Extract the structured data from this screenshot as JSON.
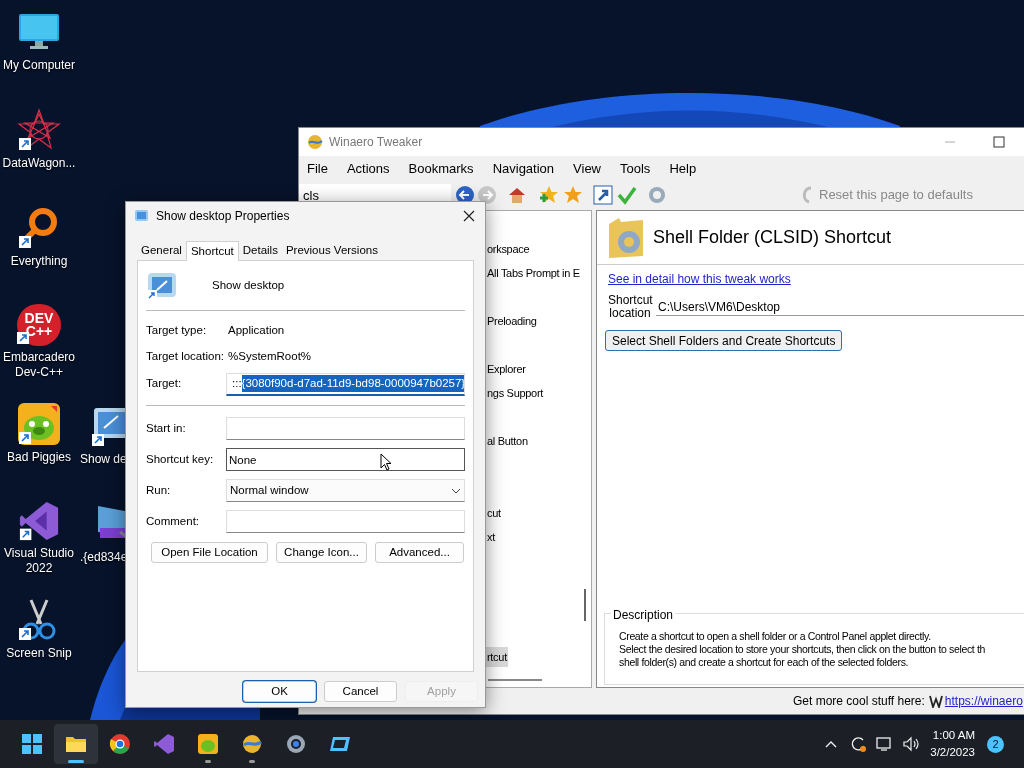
{
  "desktop_icons": [
    {
      "label": "My Computer",
      "shortcut": false
    },
    {
      "label": "DataWagon...",
      "shortcut": true
    },
    {
      "label": "Everything",
      "shortcut": true
    },
    {
      "label": "Embarcadero Dev-C++",
      "shortcut": true,
      "icon_text": [
        "DEV",
        "C++"
      ]
    },
    {
      "label": "Bad Piggies",
      "shortcut": true
    },
    {
      "label": "Visual Studio 2022",
      "shortcut": true
    },
    {
      "label": "Screen Snip",
      "shortcut": true
    }
  ],
  "desktop_icons_2": [
    {
      "label": "Show de",
      "shortcut": true
    },
    {
      "label": ".{ed834e",
      "shortcut": false
    }
  ],
  "winaero": {
    "title": "Winaero Tweaker",
    "menu": [
      "File",
      "Actions",
      "Bookmarks",
      "Navigation",
      "View",
      "Tools",
      "Help"
    ],
    "search": {
      "value": "cls"
    },
    "reset_label": "Reset this page to defaults",
    "tree": [
      {
        "label": "orkspace",
        "selected": false
      },
      {
        "label": "All Tabs Prompt in E",
        "selected": false
      },
      {
        "label": "Preloading",
        "selected": false
      },
      {
        "label": "Explorer",
        "selected": false
      },
      {
        "label": "ngs Support",
        "selected": false
      },
      {
        "label": "al Button",
        "selected": false
      },
      {
        "label": "cut",
        "selected": false
      },
      {
        "label": "xt",
        "selected": false
      },
      {
        "label": "rtcut",
        "selected": true
      }
    ],
    "page": {
      "title": "Shell Folder (CLSID) Shortcut",
      "link": "See in detail how this tweak works",
      "location_label": "Shortcut location",
      "location_value": "C:\\Users\\VM6\\Desktop",
      "button": "Select Shell Folders and Create Shortcuts",
      "description_title": "Description",
      "description": [
        "Create a shortcut to open a shell folder or a Control Panel applet directly.",
        "Select the desired location to store your shortcuts, then click on the button to select th",
        "shell folder(s) and create a shortcut for each of the selected folders."
      ]
    },
    "status": {
      "label": "Get more cool stuff here:",
      "link": "https://winaero"
    }
  },
  "dialog": {
    "title": "Show desktop Properties",
    "tabs": [
      {
        "label": "General",
        "selected": false
      },
      {
        "label": "Shortcut",
        "selected": true
      },
      {
        "label": "Details",
        "selected": false
      },
      {
        "label": "Previous Versions",
        "selected": false
      }
    ],
    "name": "Show desktop",
    "info": [
      {
        "label": "Target type:",
        "value": "Application"
      },
      {
        "label": "Target location:",
        "value": "%SystemRoot%"
      }
    ],
    "target": {
      "label": "Target:",
      "value": ":::",
      "selection": "{3080f90d-d7ad-11d9-bd98-0000947b0257}",
      "focused": true
    },
    "fields": [
      {
        "kind": "text",
        "label": "Start in:",
        "hovered": false
      },
      {
        "kind": "text",
        "label": "Shortcut key:",
        "value": "None",
        "hovered": true
      },
      {
        "kind": "select",
        "label": "Run:",
        "value": "Normal window",
        "hovered": false
      },
      {
        "kind": "text",
        "label": "Comment:",
        "hovered": false
      }
    ],
    "actions": [
      "Open File Location",
      "Change Icon...",
      "Advanced..."
    ],
    "buttons": [
      {
        "label": "OK",
        "default": true,
        "disabled": false
      },
      {
        "label": "Cancel",
        "default": false,
        "disabled": false
      },
      {
        "label": "Apply",
        "default": false,
        "disabled": true
      }
    ]
  },
  "taskbar": {
    "apps": [
      {
        "selected": false,
        "running": false
      },
      {
        "selected": true,
        "running": true
      },
      {
        "selected": false,
        "running": false
      },
      {
        "selected": false,
        "running": false
      },
      {
        "selected": false,
        "running": true
      },
      {
        "selected": false,
        "running": true
      },
      {
        "selected": false,
        "running": false
      },
      {
        "selected": false,
        "running": false
      }
    ],
    "time": "1:00 AM",
    "date": "3/2/2023",
    "notifications": "2"
  }
}
